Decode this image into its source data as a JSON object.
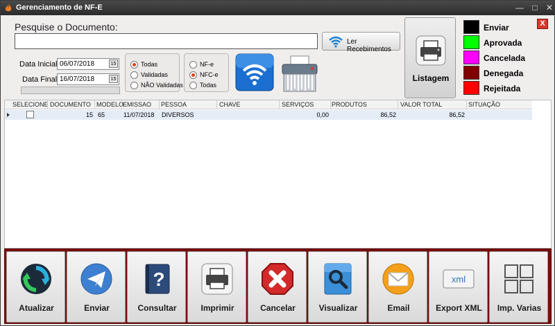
{
  "window": {
    "title": "Gerenciamento de NF-E",
    "minimize": "—",
    "maximize": "□",
    "close": "✕"
  },
  "search": {
    "label": "Pesquise o Documento:",
    "value": "",
    "ler_label": "Ler Recebimentos"
  },
  "dates": {
    "inicial_label": "Data Inicial:",
    "inicial_value": "06/07/2018",
    "final_label": "Data Final:",
    "final_value": "16/07/2018",
    "cal_glyph": "15"
  },
  "status_filter": {
    "options": [
      "Todas",
      "Validadas",
      "NÃO Validadas"
    ],
    "selected": "Todas"
  },
  "type_filter": {
    "options": [
      "NF-e",
      "NFC-e",
      "Todas"
    ],
    "selected": "NFC-e"
  },
  "listagem_label": "Listagem",
  "legend": [
    {
      "label": "Enviar",
      "color": "#000000"
    },
    {
      "label": "Aprovada",
      "color": "#00ff00"
    },
    {
      "label": "Cancelada",
      "color": "#ff00ff"
    },
    {
      "label": "Denegada",
      "color": "#800000"
    },
    {
      "label": "Rejeitada",
      "color": "#ff0000"
    }
  ],
  "close_panel": "X",
  "grid": {
    "columns": [
      "SELECIONE",
      "DOCUMENTO",
      "MODELO",
      "EMISSAO",
      "PESSOA",
      "CHAVE",
      "SERVIÇOS",
      "PRODUTOS",
      "VALOR TOTAL",
      "SITUAÇÃO"
    ],
    "rows": [
      {
        "documento": "15",
        "modelo": "65",
        "emissao": "11/07/2018",
        "pessoa": "DIVERSOS",
        "chave": "",
        "servicos": "0,00",
        "produtos": "86,52",
        "valor_total": "86,52",
        "situacao": ""
      }
    ]
  },
  "toolbar": {
    "atualizar": "Atualizar",
    "enviar": "Enviar",
    "consultar": "Consultar",
    "imprimir": "Imprimir",
    "cancelar": "Cancelar",
    "visualizar": "Visualizar",
    "email": "Email",
    "export_xml": "Export XML",
    "imp_varias": "Imp. Varias",
    "xml_icon_text": "xml"
  },
  "colors": {
    "accent": "#7a0d0d",
    "selected_row": "#e4ecf5",
    "radio_on": "#e0401a"
  }
}
